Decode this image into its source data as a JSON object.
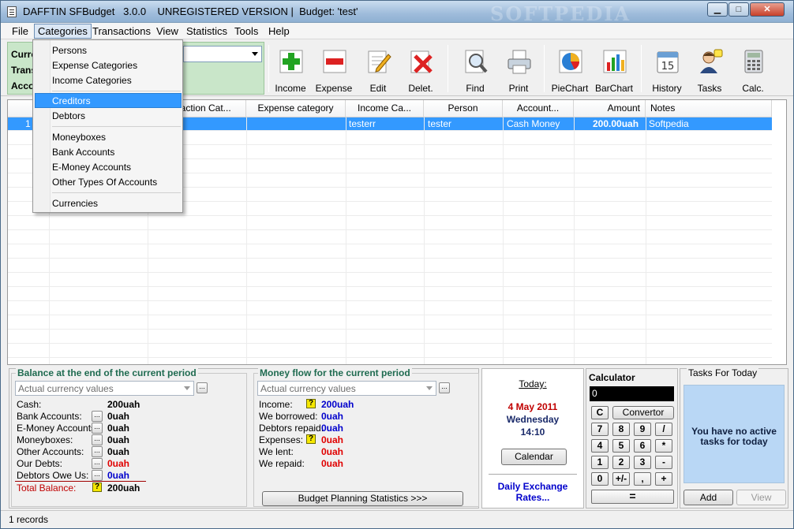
{
  "window": {
    "title": "DAFFTIN SFBudget   3.0.0    UNREGISTERED VERSION |  Budget: 'test'",
    "watermark": "SOFTPEDIA",
    "min": "0",
    "max": "1",
    "close": "r"
  },
  "menubar": [
    "File",
    "Categories",
    "Transactions",
    "View",
    "Statistics",
    "Tools",
    "Help"
  ],
  "green_panel": [
    "Curre",
    "Trans",
    "Acco"
  ],
  "toolbar": [
    {
      "label": "Income",
      "icon": "plus-icon"
    },
    {
      "label": "Expense",
      "icon": "minus-icon"
    },
    {
      "label": "Edit",
      "icon": "edit-icon"
    },
    {
      "label": "Delet.",
      "icon": "delete-icon"
    },
    {
      "label": "Find",
      "icon": "find-icon"
    },
    {
      "label": "Print",
      "icon": "print-icon"
    },
    {
      "label": "PieChart",
      "icon": "piechart-icon"
    },
    {
      "label": "BarChart",
      "icon": "barchart-icon"
    },
    {
      "label": "History",
      "icon": "calendar-icon"
    },
    {
      "label": "Tasks",
      "icon": "tasks-icon"
    },
    {
      "label": "Calc.",
      "icon": "calculator-icon"
    }
  ],
  "grid": {
    "headers": [
      "ransaction Cat...",
      "Expense category",
      "Income Ca...",
      "Person",
      "Account...",
      "Amount",
      "Notes"
    ],
    "row": {
      "index": "1",
      "income_category": "testerr",
      "person": "tester",
      "account": "Cash Money",
      "amount": "200.00uah",
      "notes": "Softpedia"
    }
  },
  "categories_menu": {
    "items": [
      "Persons",
      "Expense Categories",
      "Income Categories",
      "Creditors",
      "Debtors",
      "Moneyboxes",
      "Bank Accounts",
      "E-Money Accounts",
      "Other Types Of Accounts",
      "Currencies"
    ],
    "highlighted": "Creditors"
  },
  "balance": {
    "title": "Balance at the end of the current period",
    "combo": "Actual currency values",
    "rows": [
      {
        "label": "Cash:",
        "value": "200uah",
        "color": "#000000"
      },
      {
        "label": "Bank Accounts:",
        "value": "0uah",
        "color": "#000000"
      },
      {
        "label": "E-Money Accounts:",
        "value": "0uah",
        "color": "#000000"
      },
      {
        "label": "Moneyboxes:",
        "value": "0uah",
        "color": "#000000"
      },
      {
        "label": "Other Accounts:",
        "value": "0uah",
        "color": "#000000"
      },
      {
        "label": "Our Debts:",
        "value": "0uah",
        "color": "#e00000"
      },
      {
        "label": "Debtors Owe Us:",
        "value": "0uah",
        "color": "#0000cc"
      }
    ],
    "total_label": "Total Balance:",
    "total_value": "200uah"
  },
  "moneyflow": {
    "title": "Money flow for the current period",
    "combo": "Actual currency values",
    "rows": [
      {
        "label": "Income:",
        "value": "200uah",
        "color": "#0000cc"
      },
      {
        "label": "We borrowed:",
        "value": "0uah",
        "color": "#0000cc"
      },
      {
        "label": "Debtors repaid:",
        "value": "0uah",
        "color": "#0000cc"
      },
      {
        "label": "Expenses:",
        "value": "0uah",
        "color": "#e00000"
      },
      {
        "label": "We lent:",
        "value": "0uah",
        "color": "#e00000"
      },
      {
        "label": "We repaid:",
        "value": "0uah",
        "color": "#e00000"
      }
    ],
    "button": "Budget Planning Statistics >>>"
  },
  "today": {
    "label": "Today:",
    "date": "4 May 2011",
    "weekday": "Wednesday",
    "time": "14:10",
    "calendar_button": "Calendar",
    "exchange_link": "Daily Exchange Rates..."
  },
  "calculator": {
    "title": "Calculator",
    "display": "0",
    "clear": "C",
    "convertor": "Convertor",
    "keys": [
      [
        "7",
        "8",
        "9",
        "/"
      ],
      [
        "4",
        "5",
        "6",
        "*"
      ],
      [
        "1",
        "2",
        "3",
        "-"
      ],
      [
        "0",
        "+/-",
        ",",
        "+"
      ]
    ],
    "equals": "="
  },
  "tasks": {
    "title": "Tasks For Today",
    "message": "You have no active tasks for today",
    "add": "Add",
    "view": "View"
  },
  "status": "1 records"
}
